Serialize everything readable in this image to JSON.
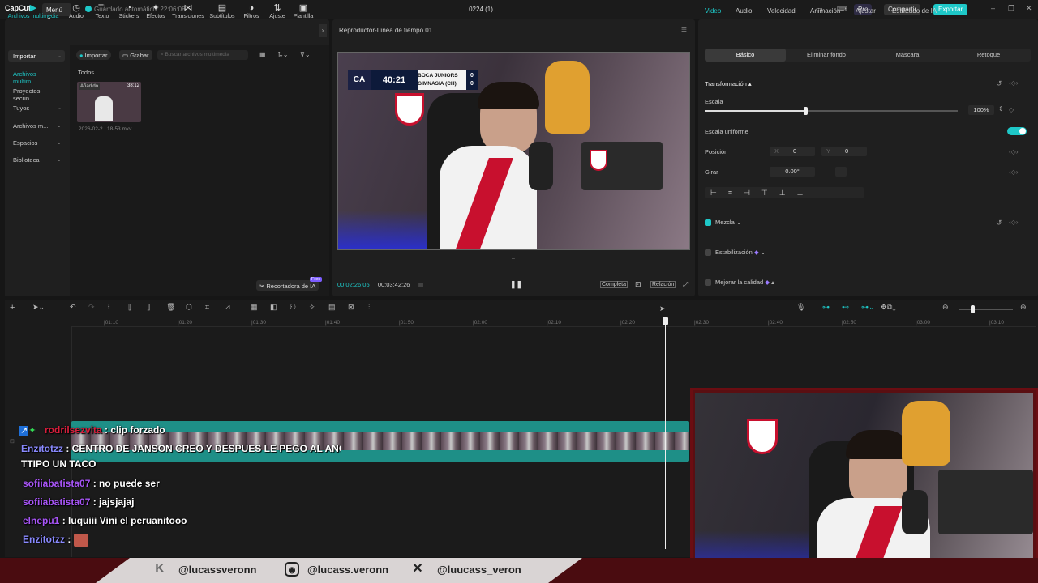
{
  "titlebar": {
    "app": "CapCut",
    "menu": "Menú",
    "autosave": "Guardado automático: 22:06:08",
    "project": "0224 (1)",
    "pro": "Pro",
    "share": "Compartir",
    "export": "Exportar"
  },
  "tooltabs": [
    "Archivos multimedia",
    "Audio",
    "Texto",
    "Stickers",
    "Efectos",
    "Transiciones",
    "Subtítulos",
    "Filtros",
    "Ajuste",
    "Plantilla"
  ],
  "sidebar": {
    "items": [
      "Importar",
      "Archivos multim...",
      "Proyectos secun...",
      "Tuyos",
      "Archivos m...",
      "Espacios",
      "Biblioteca"
    ]
  },
  "media": {
    "import": "Importar",
    "record": "Grabar",
    "search_placeholder": "Buscar archivos multimedia",
    "section": "Todos",
    "clip_badge": "Añadido",
    "clip_duration": "38:12",
    "clip_name": "2026-02-2...18-53.mkv",
    "ai_recorder": "Recortadora de IA",
    "free_badge": "Free"
  },
  "player": {
    "title": "Reproductor-Línea de tiempo 01",
    "current_time": "00:02:26:05",
    "duration": "00:03:42:26",
    "full": "Completa",
    "ratio": "Relación",
    "scoreboard": {
      "logo": "CA",
      "clock": "40:21",
      "team1": "BOCA JUNIORS",
      "team2": "GIMNASIA (CH)",
      "score1": "0",
      "score2": "0"
    }
  },
  "props": {
    "tabs": [
      "Video",
      "Audio",
      "Velocidad",
      "Animación",
      "Ajustar",
      "Estilizado de IA"
    ],
    "subtabs": [
      "Básico",
      "Eliminar fondo",
      "Máscara",
      "Retoque"
    ],
    "transform": "Transformación",
    "scale": "Escala",
    "scale_value": "100%",
    "scale_level": 0.1,
    "uniform_scale": "Escala uniforme",
    "position": "Posición",
    "pos_x_label": "X",
    "pos_x": "0",
    "pos_y_label": "Y",
    "pos_y": "0",
    "rotate": "Girar",
    "rotate_value": "0.00°",
    "blend": "Mezcla",
    "stabilization": "Estabilización",
    "quality": "Mejorar la calidad"
  },
  "timeline": {
    "ticks": [
      "|01:10",
      "|01:20",
      "|01:30",
      "|01:40",
      "|01:50",
      "|02:00",
      "|02:10",
      "|02:20",
      "|02:30",
      "|02:40",
      "|02:50",
      "|03:00",
      "|03:10"
    ]
  },
  "chat": [
    {
      "user": "rodrilsezvita",
      "text": ": clip forzado",
      "color": "#d81e3c"
    },
    {
      "user": "Enzitotzz",
      "text": ": CENTRO DE JANSON CREO Y DESPUES LE PEGO AL ANGU",
      "color": "#8a8aff"
    },
    {
      "user": "",
      "text": "TTIPO UN TACO",
      "color": "#ffffff"
    },
    {
      "user": "sofiiabatista07",
      "text": ": no puede ser",
      "color": "#a855f7"
    },
    {
      "user": "sofiiabatista07",
      "text": ": jajsjajaj",
      "color": "#a855f7"
    },
    {
      "user": "elnepu1",
      "text": ": luquiii Vini el peruanitooo",
      "color": "#a855f7"
    },
    {
      "user": "Enzitotzz",
      "text": ":",
      "color": "#8a8aff"
    }
  ],
  "banner": {
    "kick": "@lucassveronn",
    "instagram": "@lucass.veronn",
    "x": "@luucass_veron"
  },
  "colors": {
    "accent": "#1ec8c8",
    "banner": "#4a0c10"
  }
}
